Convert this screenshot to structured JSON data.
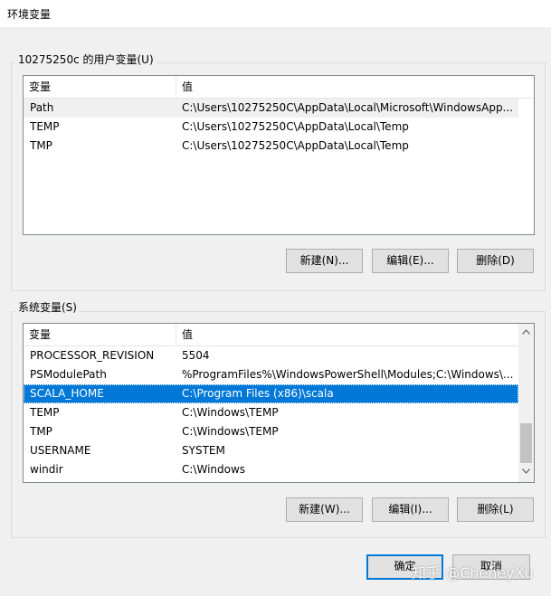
{
  "window": {
    "title": "环境变量"
  },
  "user_vars": {
    "label": "10275250c 的用户变量(U)",
    "columns": [
      "变量",
      "值"
    ],
    "rows": [
      {
        "name": "Path",
        "value": "C:\\Users\\10275250C\\AppData\\Local\\Microsoft\\WindowsApp..."
      },
      {
        "name": "TEMP",
        "value": "C:\\Users\\10275250C\\AppData\\Local\\Temp"
      },
      {
        "name": "TMP",
        "value": "C:\\Users\\10275250C\\AppData\\Local\\Temp"
      }
    ],
    "buttons": {
      "new": "新建(N)...",
      "edit": "编辑(E)...",
      "delete": "删除(D)"
    }
  },
  "system_vars": {
    "label": "系统变量(S)",
    "columns": [
      "变量",
      "值"
    ],
    "rows": [
      {
        "name": "PROCESSOR_REVISION",
        "value": "5504"
      },
      {
        "name": "PSModulePath",
        "value": "%ProgramFiles%\\WindowsPowerShell\\Modules;C:\\Windows\\..."
      },
      {
        "name": "SCALA_HOME",
        "value": "C:\\Program Files (x86)\\scala"
      },
      {
        "name": "TEMP",
        "value": "C:\\Windows\\TEMP"
      },
      {
        "name": "TMP",
        "value": "C:\\Windows\\TEMP"
      },
      {
        "name": "USERNAME",
        "value": "SYSTEM"
      },
      {
        "name": "windir",
        "value": "C:\\Windows"
      }
    ],
    "selected_row": "SCALA_HOME",
    "buttons": {
      "new": "新建(W)...",
      "edit": "编辑(I)...",
      "delete": "删除(L)"
    }
  },
  "dialog_buttons": {
    "ok": "确定",
    "cancel": "取消"
  },
  "watermark": "知乎 @CheneyXu",
  "colors": {
    "selection": "#0078d7",
    "dialog_bg": "#f0f0f0",
    "default_button_border": "#0078d7"
  },
  "icons": {
    "scroll_up": "chevron-up-icon",
    "scroll_down": "chevron-down-icon"
  }
}
